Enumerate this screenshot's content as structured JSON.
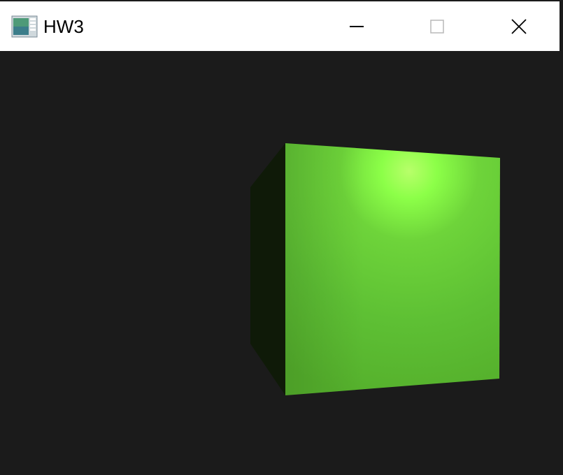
{
  "window": {
    "title": "HW3",
    "icon": "app-window-icon",
    "controls": {
      "minimize_icon": "minimize-icon",
      "maximize_icon": "maximize-icon",
      "close_icon": "close-icon"
    }
  },
  "scene": {
    "background_color": "#1b1b1b",
    "cube": {
      "front_face_color": "#5dbd32",
      "side_face_color": "#0f1a08",
      "specular_highlight_color": "#c8ff80"
    }
  }
}
